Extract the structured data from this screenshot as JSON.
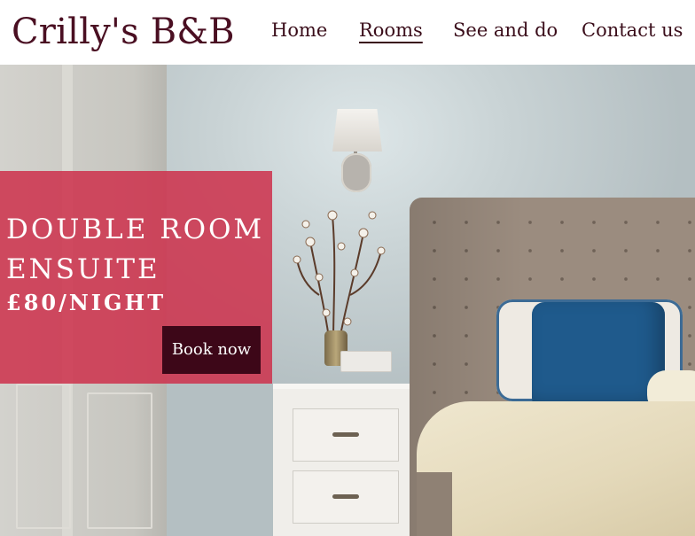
{
  "site": {
    "logo": "Crilly's B&B"
  },
  "nav": {
    "items": [
      {
        "label": "Home",
        "active": false
      },
      {
        "label": "Rooms",
        "active": true
      },
      {
        "label": "See and do",
        "active": false
      },
      {
        "label": "Contact us",
        "active": false
      }
    ]
  },
  "promo": {
    "title": "Double Room Ensuite",
    "price": "£80/NIGHT",
    "button": "Book now"
  },
  "colors": {
    "brand": "#4a0f22",
    "promo_background": "#cd344e",
    "button_background": "#3d0718",
    "pillow_blue": "#1f5a8c"
  },
  "hero_image": {
    "icon": "bedroom-photo"
  }
}
